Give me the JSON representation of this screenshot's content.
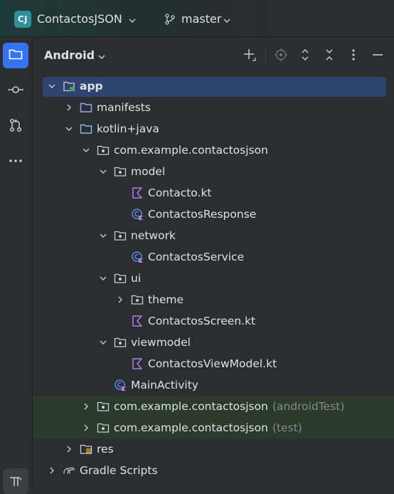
{
  "titlebar": {
    "project_badge": "CJ",
    "project_name": "ContactosJSON",
    "branch_name": "master"
  },
  "toolstrip": {
    "items": [
      "folder-icon",
      "commit-icon",
      "pull-requests-icon",
      "more-icon",
      "build-icon"
    ]
  },
  "panel": {
    "title": "Android"
  },
  "tree": {
    "rows": [
      {
        "label": "app",
        "suffix": "",
        "icon": "module-icon",
        "expanded": true,
        "selected": true
      },
      {
        "label": "manifests",
        "suffix": "",
        "icon": "folder-icon",
        "expanded": false
      },
      {
        "label": "kotlin+java",
        "suffix": "",
        "icon": "folder-icon",
        "expanded": true
      },
      {
        "label": "com.example.contactosjson",
        "suffix": "",
        "icon": "package-icon",
        "expanded": true
      },
      {
        "label": "model",
        "suffix": "",
        "icon": "package-icon",
        "expanded": true
      },
      {
        "label": "Contacto.kt",
        "suffix": "",
        "icon": "kotlin-file-icon"
      },
      {
        "label": "ContactosResponse",
        "suffix": "",
        "icon": "kotlin-class-icon"
      },
      {
        "label": "network",
        "suffix": "",
        "icon": "package-icon",
        "expanded": true
      },
      {
        "label": "ContactosService",
        "suffix": "",
        "icon": "kotlin-class-icon"
      },
      {
        "label": "ui",
        "suffix": "",
        "icon": "package-icon",
        "expanded": true
      },
      {
        "label": "theme",
        "suffix": "",
        "icon": "package-icon",
        "expanded": false
      },
      {
        "label": "ContactosScreen.kt",
        "suffix": "",
        "icon": "kotlin-file-icon"
      },
      {
        "label": "viewmodel",
        "suffix": "",
        "icon": "package-icon",
        "expanded": true
      },
      {
        "label": "ContactosViewModel.kt",
        "suffix": "",
        "icon": "kotlin-file-icon"
      },
      {
        "label": "MainActivity",
        "suffix": "",
        "icon": "kotlin-class-icon"
      },
      {
        "label": "com.example.contactosjson",
        "suffix": "(androidTest)",
        "icon": "package-icon",
        "expanded": false
      },
      {
        "label": "com.example.contactosjson",
        "suffix": "(test)",
        "icon": "package-icon",
        "expanded": false
      },
      {
        "label": "res",
        "suffix": "",
        "icon": "resources-folder-icon",
        "expanded": false
      },
      {
        "label": "Gradle Scripts",
        "suffix": "",
        "icon": "gradle-icon",
        "expanded": false
      }
    ]
  },
  "colors": {
    "accent": "#3574f0",
    "selection": "#2e436e",
    "test_tint": "#2b3a2a",
    "folder_blue": "#8fb4f5",
    "kotlin_purple": "#b07fe8"
  }
}
